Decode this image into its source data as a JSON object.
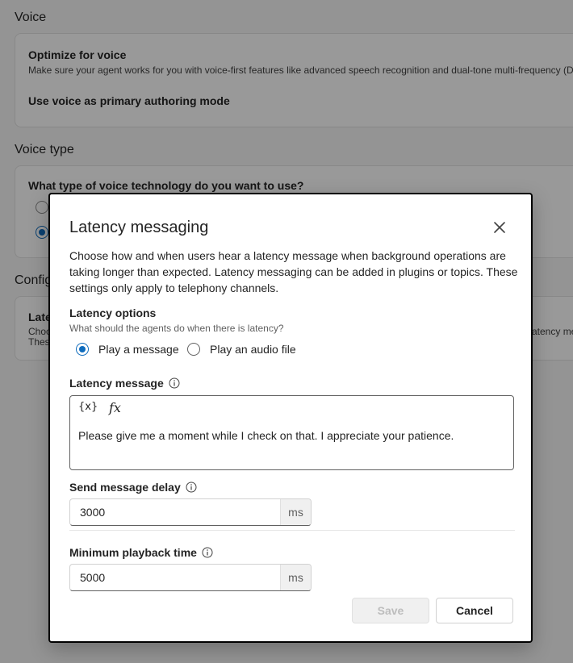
{
  "background": {
    "voice_section_title": "Voice",
    "optimize_title": "Optimize for voice",
    "optimize_desc": "Make sure your agent works for you with voice-first features like advanced speech recognition and dual-tone multi-frequency (D",
    "primary_mode_title": "Use voice as primary authoring mode",
    "voice_type_title": "Voice type",
    "voice_tech_question": "What type of voice technology do you want to use?",
    "config_section_title": "Config",
    "latency_card_title": "Late",
    "latency_card_desc1": "Choo",
    "latency_card_desc2": "Thes",
    "latency_card_right": "atency mes"
  },
  "dialog": {
    "title": "Latency messaging",
    "description": "Choose how and when users hear a latency message when background operations are taking longer than expected. Latency messaging can be added in plugins or topics. These settings only apply to telephony channels.",
    "latency_options_label": "Latency options",
    "latency_options_hint": "What should the agents do when there is latency?",
    "radio_play_message": "Play a message",
    "radio_play_audio": "Play an audio file",
    "latency_message_label": "Latency message",
    "var_button": "{x}",
    "fx_button": "fx",
    "latency_message_text": "Please give me a moment while I check on that. I appreciate your patience.",
    "send_delay_label": "Send message delay",
    "send_delay_value": "3000",
    "send_delay_unit": "ms",
    "min_playback_label": "Minimum playback time",
    "min_playback_value": "5000",
    "min_playback_unit": "ms",
    "save_label": "Save",
    "cancel_label": "Cancel"
  },
  "selected_option": "Play a message"
}
